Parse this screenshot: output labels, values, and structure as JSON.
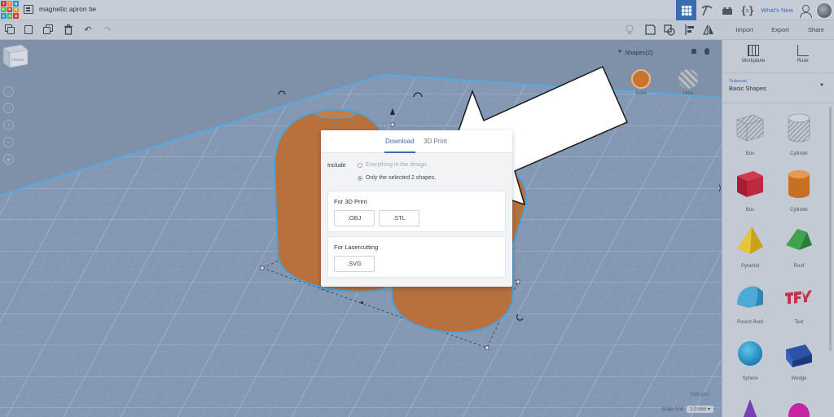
{
  "app": {
    "logo_letters": [
      "TIN",
      "KER",
      "CAD"
    ],
    "design_title": "magnetic apron tie",
    "whats_new": "What's New"
  },
  "top_actions": [
    "Import",
    "Export",
    "Share"
  ],
  "view_cube": {
    "face_label": "FRONT"
  },
  "inspector": {
    "title": "Shapes(2)",
    "solid_label": "Solid",
    "hole_label": "Hole",
    "solid_color": "#c97432"
  },
  "dialog": {
    "tabs": [
      "Download",
      "3D Print"
    ],
    "active_tab": "Download",
    "include_label": "Include",
    "options": [
      {
        "label": "Everything in the design.",
        "checked": false,
        "disabled": true
      },
      {
        "label": "Only the selected 2 shapes.",
        "checked": true,
        "disabled": false
      }
    ],
    "sections": [
      {
        "title": "For 3D Print",
        "buttons": [
          ".OBJ",
          ".STL"
        ]
      },
      {
        "title": "For Lasercutting",
        "buttons": [
          ".SVG"
        ]
      }
    ]
  },
  "panel": {
    "workplane_label": "Workplane",
    "ruler_label": "Ruler",
    "library_provider": "Tinkercad",
    "library_name": "Basic Shapes",
    "shapes": [
      {
        "name": "Box",
        "kind": "box-hole"
      },
      {
        "name": "Cylinder",
        "kind": "cylinder-hole"
      },
      {
        "name": "Box",
        "kind": "box"
      },
      {
        "name": "Cylinder",
        "kind": "cylinder"
      },
      {
        "name": "Pyramid",
        "kind": "pyramid"
      },
      {
        "name": "Roof",
        "kind": "roof"
      },
      {
        "name": "Round Roof",
        "kind": "round-roof"
      },
      {
        "name": "Text",
        "kind": "text"
      },
      {
        "name": "Sphere",
        "kind": "sphere"
      },
      {
        "name": "Wedge",
        "kind": "wedge"
      }
    ]
  },
  "grid": {
    "edit_grid": "Edit grid",
    "snap_label": "Snap Grid",
    "snap_value": "1.0 mm"
  },
  "colors": {
    "accent": "#3a6db0",
    "object_orange": "#b8703c",
    "overlay": "#7f90a9"
  }
}
